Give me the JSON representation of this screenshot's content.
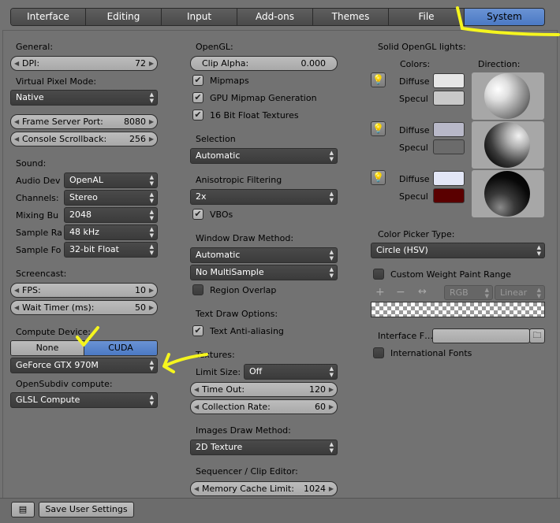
{
  "tabs": [
    {
      "label": "Interface"
    },
    {
      "label": "Editing"
    },
    {
      "label": "Input"
    },
    {
      "label": "Add-ons"
    },
    {
      "label": "Themes"
    },
    {
      "label": "File"
    },
    {
      "label": "System"
    }
  ],
  "col1": {
    "general_title": "General:",
    "dpi_label": "DPI:",
    "dpi_value": "72",
    "vpm_title": "Virtual Pixel Mode:",
    "vpm_value": "Native",
    "fsp_label": "Frame Server Port:",
    "fsp_value": "8080",
    "csb_label": "Console Scrollback:",
    "csb_value": "256",
    "sound_title": "Sound:",
    "audio_dev_label": "Audio Dev",
    "audio_dev_value": "OpenAL",
    "channels_label": "Channels:",
    "channels_value": "Stereo",
    "mixing_label": "Mixing Bu",
    "mixing_value": "2048",
    "srate_label": "Sample Ra",
    "srate_value": "48 kHz",
    "sformat_label": "Sample Fo",
    "sformat_value": "32-bit Float",
    "screencast_title": "Screencast:",
    "fps_label": "FPS:",
    "fps_value": "10",
    "wait_label": "Wait Timer (ms):",
    "wait_value": "50",
    "compute_title": "Compute Device:",
    "compute_none": "None",
    "compute_cuda": "CUDA",
    "gpu_value": "GeForce GTX 970M",
    "opensubdiv_title": "OpenSubdiv compute:",
    "opensubdiv_value": "GLSL Compute"
  },
  "col2": {
    "opengl_title": "OpenGL:",
    "clip_label": "Clip Alpha:",
    "clip_value": "0.000",
    "mipmaps": "Mipmaps",
    "gpu_mipmap": "GPU Mipmap Generation",
    "float_tex": "16 Bit Float Textures",
    "selection_title": "Selection",
    "selection_value": "Automatic",
    "aniso_title": "Anisotropic Filtering",
    "aniso_value": "2x",
    "vbos": "VBOs",
    "wdm_title": "Window Draw Method:",
    "wdm_value": "Automatic",
    "multisample_value": "No MultiSample",
    "region_overlap": "Region Overlap",
    "tdo_title": "Text Draw Options:",
    "anti_alias": "Text Anti-aliasing",
    "textures_title": "Textures:",
    "limit_label": "Limit Size:",
    "limit_value": "Off",
    "timeout_label": "Time Out:",
    "timeout_value": "120",
    "collection_label": "Collection Rate:",
    "collection_value": "60",
    "idm_title": "Images Draw Method:",
    "idm_value": "2D Texture",
    "seq_title": "Sequencer / Clip Editor:",
    "memcache_label": "Memory Cache Limit:",
    "memcache_value": "1024"
  },
  "col3": {
    "lights_title": "Solid OpenGL lights:",
    "colors_title": "Colors:",
    "direction_title": "Direction:",
    "diffuse": "Diffuse",
    "specular": "Specul",
    "colors": {
      "l1_diffuse": "#e6e6e6",
      "l1_spec": "#c9c9c9",
      "l2_diffuse": "#b8b8c8",
      "l2_spec": "#6b6b6b",
      "l3_diffuse": "#e2e6f6",
      "l3_spec": "#5a0000"
    },
    "cpt_title": "Color Picker Type:",
    "cpt_value": "Circle (HSV)",
    "cwpr": "Custom Weight Paint Range",
    "rgb_value": "RGB",
    "linear_value": "Linear",
    "iface_font_label": "Interface F…",
    "intl_fonts": "International Fonts"
  },
  "bottom": {
    "save_label": "Save User Settings"
  },
  "accent": "#5680c2",
  "annotation_color": "#f5f51e"
}
